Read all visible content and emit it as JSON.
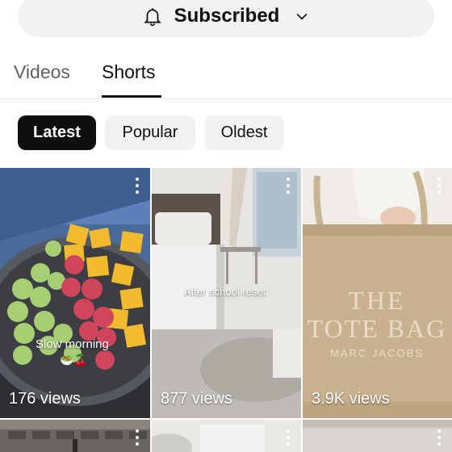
{
  "subscribe": {
    "label": "Subscribed",
    "icon": "bell-icon"
  },
  "tabs": [
    {
      "label": "Videos",
      "active": false
    },
    {
      "label": "Shorts",
      "active": true
    }
  ],
  "filters": [
    {
      "label": "Latest",
      "selected": true
    },
    {
      "label": "Popular",
      "selected": false
    },
    {
      "label": "Oldest",
      "selected": false
    }
  ],
  "shorts": [
    {
      "views": "176 views",
      "overlay_text": "Slow morning",
      "overlay_emoji": "🥗🍒"
    },
    {
      "views": "877 views",
      "overlay_text": "After school reset"
    },
    {
      "views": "3.9K views",
      "bag_text": [
        "THE",
        "TOTE BAG",
        "MARC JACOBS"
      ]
    },
    {
      "views": ""
    },
    {
      "views": ""
    },
    {
      "views": ""
    }
  ]
}
